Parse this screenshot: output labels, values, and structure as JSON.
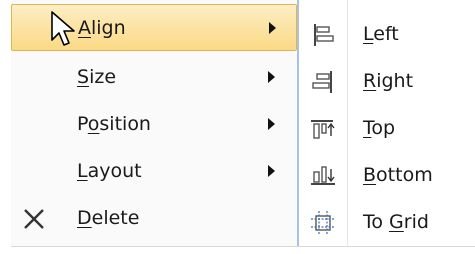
{
  "menu": {
    "items": [
      {
        "label_pre": "",
        "label_key": "A",
        "label_post": "lign",
        "has_submenu": true,
        "highlighted": true
      },
      {
        "label_pre": "",
        "label_key": "S",
        "label_post": "ize",
        "has_submenu": true
      },
      {
        "label_pre": "P",
        "label_key": "o",
        "label_post": "sition",
        "has_submenu": true
      },
      {
        "label_pre": "",
        "label_key": "L",
        "label_post": "ayout",
        "has_submenu": true
      },
      {
        "label_pre": "",
        "label_key": "D",
        "label_post": "elete",
        "has_submenu": false,
        "icon": "close-x-icon"
      }
    ]
  },
  "submenu": {
    "items": [
      {
        "label_pre": "",
        "label_key": "L",
        "label_post": "eft",
        "icon": "align-left-icon"
      },
      {
        "label_pre": "",
        "label_key": "R",
        "label_post": "ight",
        "icon": "align-right-icon"
      },
      {
        "label_pre": "",
        "label_key": "T",
        "label_post": "op",
        "icon": "align-top-icon"
      },
      {
        "label_pre": "",
        "label_key": "B",
        "label_post": "ottom",
        "icon": "align-bottom-icon"
      },
      {
        "label_pre": "To ",
        "label_key": "G",
        "label_post": "rid",
        "icon": "align-to-grid-icon"
      }
    ]
  },
  "colors": {
    "highlight": "#fbd986",
    "submenu_border": "#a6c3e6"
  }
}
